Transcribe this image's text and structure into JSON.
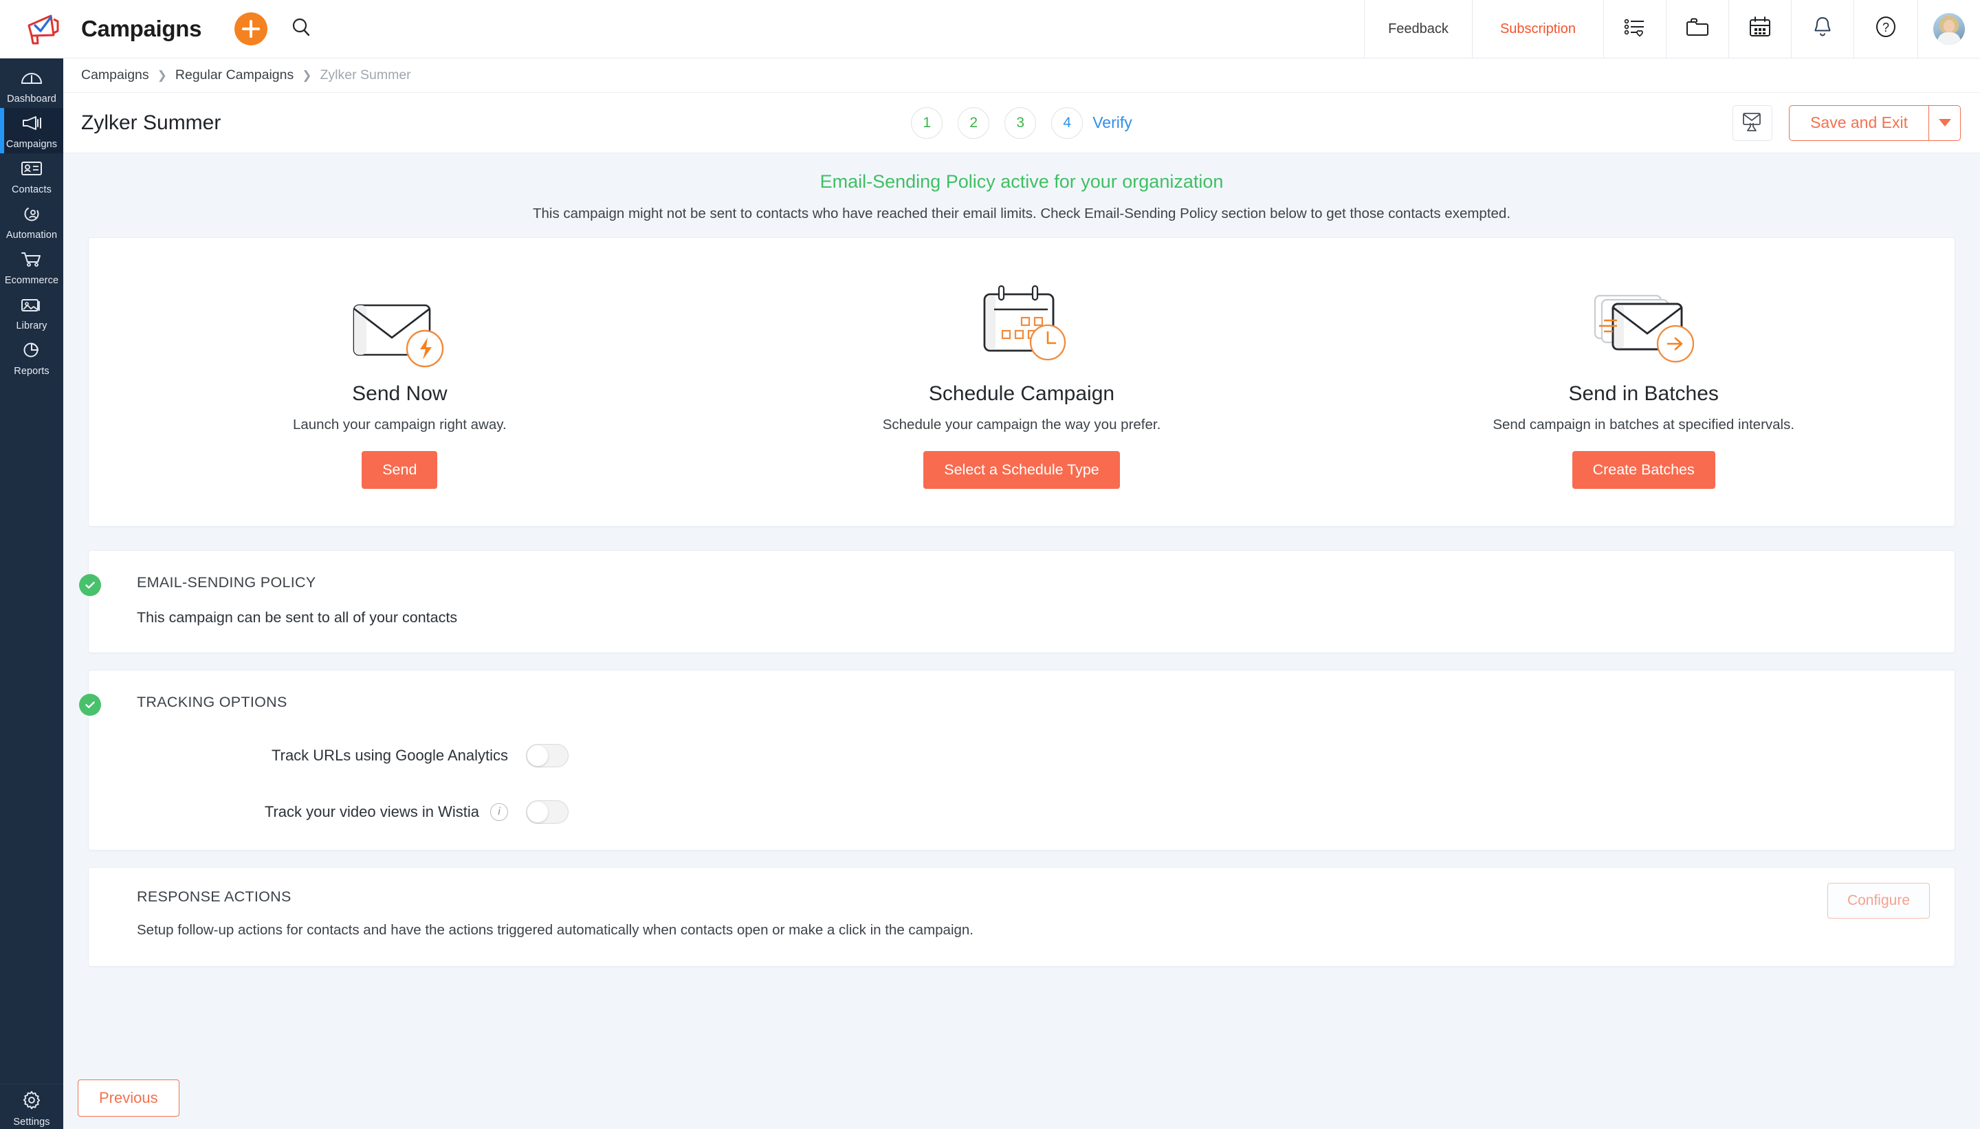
{
  "topbar": {
    "brand": "Campaigns",
    "logo_icon": "megaphone-logo",
    "add_icon": "plus-icon",
    "search_icon": "search-icon",
    "feedback": "Feedback",
    "subscription": "Subscription",
    "icons": [
      "list-heart-icon",
      "folder-icon",
      "calendar-icon",
      "bell-icon",
      "help-icon"
    ],
    "avatar_icon": "user-avatar"
  },
  "sidebar": {
    "items": [
      {
        "label": "Dashboard",
        "icon": "gauge-icon",
        "active": false
      },
      {
        "label": "Campaigns",
        "icon": "megaphone-icon",
        "active": true
      },
      {
        "label": "Contacts",
        "icon": "contact-card-icon",
        "active": false
      },
      {
        "label": "Automation",
        "icon": "automation-icon",
        "active": false
      },
      {
        "label": "Ecommerce",
        "icon": "cart-icon",
        "active": false
      },
      {
        "label": "Library",
        "icon": "image-icon",
        "active": false
      },
      {
        "label": "Reports",
        "icon": "pie-chart-icon",
        "active": false
      }
    ],
    "bottom": {
      "label": "Settings",
      "icon": "gear-icon"
    }
  },
  "breadcrumb": [
    {
      "label": "Campaigns",
      "current": false
    },
    {
      "label": "Regular Campaigns",
      "current": false
    },
    {
      "label": "Zylker Summer",
      "current": true
    }
  ],
  "header": {
    "page_title": "Zylker Summer",
    "steps": [
      {
        "number": "1",
        "state": "done"
      },
      {
        "number": "2",
        "state": "done"
      },
      {
        "number": "3",
        "state": "done"
      },
      {
        "number": "4",
        "state": "current"
      }
    ],
    "current_step_label": "Verify",
    "test_email_icon": "envelope-flask-icon",
    "save_label": "Save and Exit",
    "save_caret_icon": "chevron-down-icon"
  },
  "banner": {
    "title": "Email-Sending Policy active for your organization",
    "description": "This campaign might not be sent to contacts who have reached their email limits. Check Email-Sending Policy section below to get those contacts exempted."
  },
  "send_options": [
    {
      "icon": "envelope-bolt-icon",
      "title": "Send Now",
      "description": "Launch your campaign right away.",
      "button": "Send"
    },
    {
      "icon": "calendar-clock-icon",
      "title": "Schedule Campaign",
      "description": "Schedule your campaign the way you prefer.",
      "button": "Select a Schedule Type"
    },
    {
      "icon": "envelopes-arrow-icon",
      "title": "Send in Batches",
      "description": "Send campaign in batches at specified intervals.",
      "button": "Create Batches"
    }
  ],
  "policy_section": {
    "check_icon": "check-circle-icon",
    "title": "EMAIL-SENDING POLICY",
    "description": "This campaign can be sent to all of your contacts"
  },
  "tracking_section": {
    "check_icon": "check-circle-icon",
    "title": "TRACKING OPTIONS",
    "rows": [
      {
        "label": "Track URLs using Google Analytics",
        "has_info": false,
        "enabled": false
      },
      {
        "label": "Track your video views in Wistia",
        "has_info": true,
        "info_icon": "info-icon",
        "enabled": false
      }
    ]
  },
  "response_section": {
    "title": "RESPONSE ACTIONS",
    "description": "Setup follow-up actions for contacts and have the actions triggered automatically when contacts open or make a click in the campaign.",
    "configure_button": "Configure"
  },
  "footer": {
    "previous_button": "Previous"
  },
  "colors": {
    "accent_orange": "#f86b4f",
    "brand_orange": "#f2714f",
    "sidebar_bg": "#1d2d42",
    "active_bar": "#2596f5",
    "success_green": "#3fbf63",
    "step_blue": "#2f8fe8",
    "page_bg": "#f2f6fb"
  }
}
